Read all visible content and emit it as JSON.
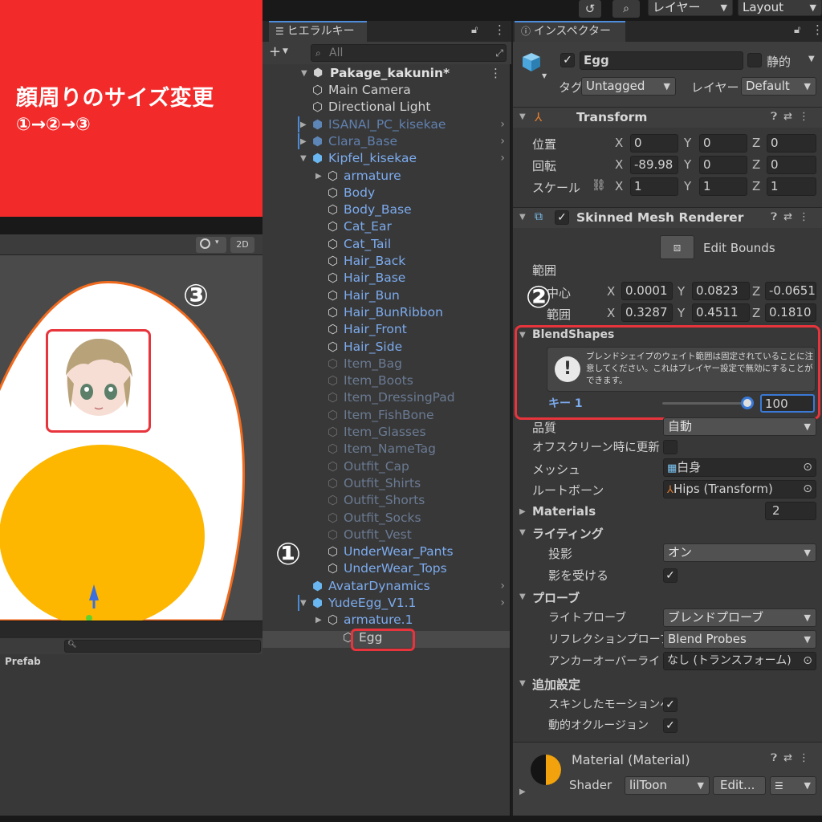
{
  "banner": {
    "title": "顔周りのサイズ変更",
    "steps": "①→②→③"
  },
  "annotations": {
    "step1": "①",
    "step2": "②",
    "step3": "③"
  },
  "topbar": {
    "history_icon": "history-icon",
    "search_icon": "search-icon",
    "layers_label": "レイヤー",
    "layout_label": "Layout"
  },
  "scene": {
    "mode_2d": "2D",
    "colors": {
      "egg_white": "#ffffff",
      "egg_outline": "#f06a1e",
      "yolk": "#fdb700",
      "scene_bg": "#4a4a4a"
    }
  },
  "project": {
    "prefab_label": "Prefab"
  },
  "hierarchy": {
    "tab_label": "ヒエラルキー",
    "search_placeholder": "All",
    "scene_name": "Pakage_kakunin*",
    "rows": [
      {
        "label": "Main Camera",
        "style": "white",
        "icon": "gameobject-icon"
      },
      {
        "label": "Directional Light",
        "style": "white",
        "icon": "gameobject-icon"
      },
      {
        "label": "ISANAI_PC_kisekae",
        "style": "gray",
        "icon": "prefab-icon"
      },
      {
        "label": "Clara_Base",
        "style": "gray",
        "icon": "prefab-icon"
      },
      {
        "label": "Kipfel_kisekae",
        "style": "blue",
        "icon": "prefab-icon"
      },
      {
        "label": "armature",
        "style": "blue",
        "icon": "gameobject-icon"
      },
      {
        "label": "Body",
        "style": "blue",
        "icon": "gameobject-icon"
      },
      {
        "label": "Body_Base",
        "style": "blue",
        "icon": "gameobject-icon"
      },
      {
        "label": "Cat_Ear",
        "style": "blue",
        "icon": "gameobject-icon"
      },
      {
        "label": "Cat_Tail",
        "style": "blue",
        "icon": "gameobject-icon"
      },
      {
        "label": "Hair_Back",
        "style": "blue",
        "icon": "gameobject-icon"
      },
      {
        "label": "Hair_Base",
        "style": "blue",
        "icon": "gameobject-icon"
      },
      {
        "label": "Hair_Bun",
        "style": "blue",
        "icon": "gameobject-icon"
      },
      {
        "label": "Hair_BunRibbon",
        "style": "blue",
        "icon": "gameobject-icon"
      },
      {
        "label": "Hair_Front",
        "style": "blue",
        "icon": "gameobject-icon"
      },
      {
        "label": "Hair_Side",
        "style": "blue",
        "icon": "gameobject-icon"
      },
      {
        "label": "Item_Bag",
        "style": "dim",
        "icon": "gameobject-icon"
      },
      {
        "label": "Item_Boots",
        "style": "dim",
        "icon": "gameobject-icon"
      },
      {
        "label": "Item_DressingPad",
        "style": "dim",
        "icon": "gameobject-icon"
      },
      {
        "label": "Item_FishBone",
        "style": "dim",
        "icon": "gameobject-icon"
      },
      {
        "label": "Item_Glasses",
        "style": "dim",
        "icon": "gameobject-icon"
      },
      {
        "label": "Item_NameTag",
        "style": "dim",
        "icon": "gameobject-icon"
      },
      {
        "label": "Outfit_Cap",
        "style": "dim",
        "icon": "gameobject-icon"
      },
      {
        "label": "Outfit_Shirts",
        "style": "dim",
        "icon": "gameobject-icon"
      },
      {
        "label": "Outfit_Shorts",
        "style": "dim",
        "icon": "gameobject-icon"
      },
      {
        "label": "Outfit_Socks",
        "style": "dim",
        "icon": "gameobject-icon"
      },
      {
        "label": "Outfit_Vest",
        "style": "dim",
        "icon": "gameobject-icon"
      },
      {
        "label": "UnderWear_Pants",
        "style": "blue",
        "icon": "gameobject-icon"
      },
      {
        "label": "UnderWear_Tops",
        "style": "blue",
        "icon": "gameobject-icon"
      },
      {
        "label": "AvatarDynamics",
        "style": "blue",
        "icon": "prefab-icon"
      },
      {
        "label": "YudeEgg_V1.1",
        "style": "blue",
        "icon": "prefab-icon"
      },
      {
        "label": "armature.1",
        "style": "blue",
        "icon": "gameobject-icon"
      },
      {
        "label": "Egg",
        "style": "white",
        "icon": "gameobject-icon"
      }
    ]
  },
  "inspector": {
    "tab_label": "インスペクター",
    "object_name": "Egg",
    "static_label": "静的",
    "tag_label": "タグ",
    "tag_value": "Untagged",
    "layer_label": "レイヤー",
    "layer_value": "Default",
    "transform": {
      "title": "Transform",
      "position_label": "位置",
      "rotation_label": "回転",
      "scale_label": "スケール",
      "position": {
        "x": "0",
        "y": "0",
        "z": "0"
      },
      "rotation": {
        "x": "-89.98",
        "y": "0",
        "z": "0"
      },
      "scale": {
        "x": "1",
        "y": "1",
        "z": "1"
      }
    },
    "smr": {
      "title": "Skinned Mesh Renderer",
      "edit_bounds": "Edit Bounds",
      "bounds_label": "範囲",
      "center_label": "中心",
      "extent_label": "範囲",
      "center": {
        "x": "0.0001",
        "y": "0.0823",
        "z": "-0.0651"
      },
      "extent": {
        "x": "0.3287",
        "y": "0.4511",
        "z": "0.1810"
      },
      "blendshapes_label": "BlendShapes",
      "warning_text": "ブレンドシェイプのウェイト範囲は固定されていることに注意してください。これはプレイヤー設定で無効にすることができます。",
      "key_label": "キー 1",
      "key_value": "100",
      "key_fraction": 1.0,
      "quality_label": "品質",
      "quality_value": "自動",
      "offscreen_label": "オフスクリーン時に更新",
      "mesh_label": "メッシュ",
      "mesh_value": "白身",
      "root_bone_label": "ルートボーン",
      "root_bone_value": "Hips (Transform)",
      "materials_label": "Materials",
      "materials_count": "2",
      "lighting_label": "ライティング",
      "cast_shadows_label": "投影",
      "cast_shadows_value": "オン",
      "receive_shadows_label": "影を受ける",
      "probes_label": "プローブ",
      "light_probe_label": "ライトプローブ",
      "light_probe_value": "ブレンドプローブ",
      "reflection_probe_label": "リフレクションプローブ",
      "reflection_probe_value": "Blend Probes",
      "anchor_override_label": "アンカーオーバーライド",
      "anchor_override_value": "なし (トランスフォーム)",
      "additional_label": "追加設定",
      "skinned_motion_label": "スキンしたモーションベ",
      "dynamic_occlusion_label": "動的オクルージョン"
    },
    "material": {
      "title": "Material (Material)",
      "shader_label": "Shader",
      "shader_value": "lilToon",
      "edit_label": "Edit...",
      "colors": {
        "left": "#141414",
        "right": "#f1a20c"
      }
    }
  }
}
